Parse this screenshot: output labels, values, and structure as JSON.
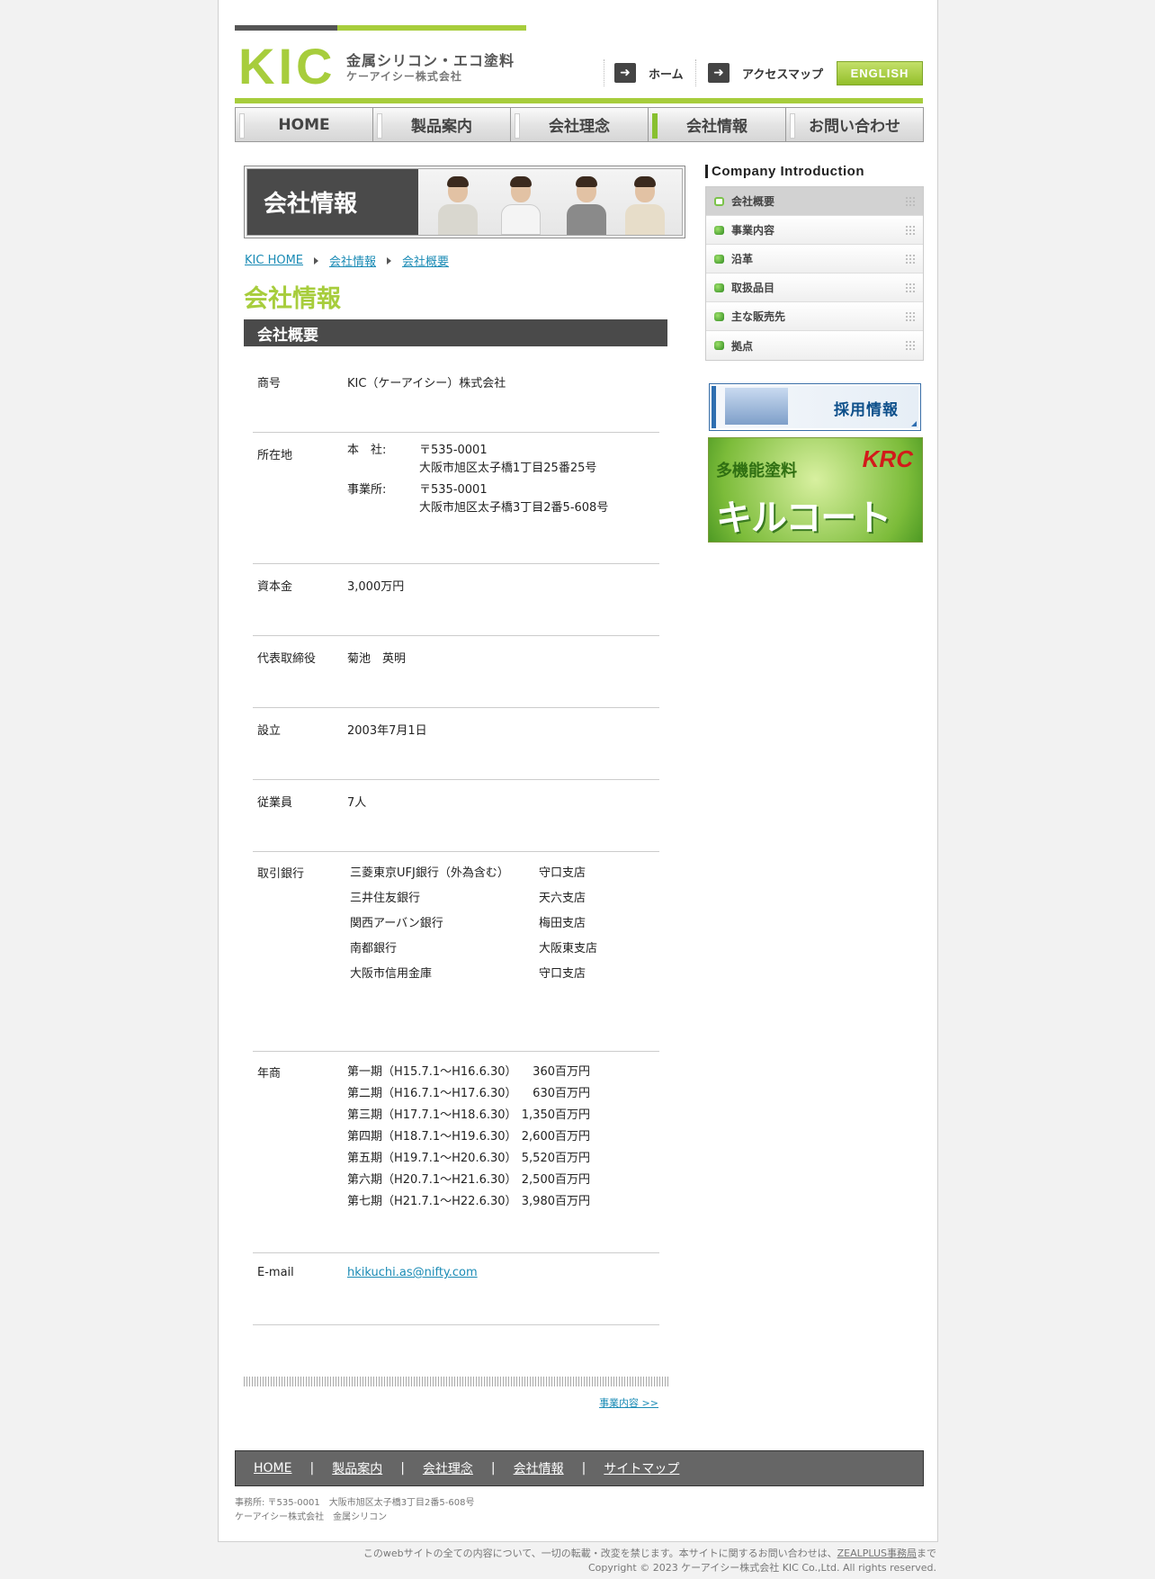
{
  "header": {
    "logo": "KIC",
    "tagline": "金属シリコン・エコ塗料",
    "company_sub": "ケーアイシー株式会社",
    "util_links": [
      {
        "label": "ホーム",
        "icon": "arrow-right-icon"
      },
      {
        "label": "アクセスマップ",
        "icon": "arrow-right-icon"
      }
    ],
    "english_label": "ENGLISH"
  },
  "nav": {
    "tabs": [
      {
        "label": "HOME"
      },
      {
        "label": "製品案内"
      },
      {
        "label": "会社理念"
      },
      {
        "label": "会社情報"
      },
      {
        "label": "お問い合わせ"
      }
    ],
    "active_index": 3
  },
  "banner": {
    "title": "会社情報"
  },
  "breadcrumb": [
    "KIC HOME",
    "会社情報",
    "会社概要"
  ],
  "page_heading": "会社情報",
  "section_title": "会社概要",
  "info": {
    "trade_name": {
      "label": "商号",
      "value": "KIC（ケーアイシー）株式会社"
    },
    "location": {
      "label": "所在地",
      "entries": [
        {
          "kind": "本　社:",
          "zip": "〒535-0001",
          "address": "大阪市旭区太子橋1丁目25番25号"
        },
        {
          "kind": "事業所:",
          "zip": "〒535-0001",
          "address": "大阪市旭区太子橋3丁目2番5-608号"
        }
      ]
    },
    "capital": {
      "label": "資本金",
      "value": "3,000万円"
    },
    "representative": {
      "label": "代表取締役",
      "value": "菊池　英明"
    },
    "established": {
      "label": "設立",
      "value": "2003年7月1日"
    },
    "employees": {
      "label": "従業員",
      "value": "7人"
    },
    "banks": {
      "label": "取引銀行",
      "items": [
        {
          "bank": "三菱東京UFJ銀行（外為含む）",
          "branch": "守口支店"
        },
        {
          "bank": "三井住友銀行",
          "branch": "天六支店"
        },
        {
          "bank": "関西アーバン銀行",
          "branch": "梅田支店"
        },
        {
          "bank": "南都銀行",
          "branch": "大阪東支店"
        },
        {
          "bank": "大阪市信用金庫",
          "branch": "守口支店"
        }
      ]
    },
    "revenue": {
      "label": "年商",
      "items": [
        {
          "period": "第一期（H15.7.1〜H16.6.30）",
          "amount": "360百万円"
        },
        {
          "period": "第二期（H16.7.1〜H17.6.30）",
          "amount": "630百万円"
        },
        {
          "period": "第三期（H17.7.1〜H18.6.30）",
          "amount": "1,350百万円"
        },
        {
          "period": "第四期（H18.7.1〜H19.6.30）",
          "amount": "2,600百万円"
        },
        {
          "period": "第五期（H19.7.1〜H20.6.30）",
          "amount": "5,520百万円"
        },
        {
          "period": "第六期（H20.7.1〜H21.6.30）",
          "amount": "2,500百万円"
        },
        {
          "period": "第七期（H21.7.1〜H22.6.30）",
          "amount": "3,980百万円"
        }
      ]
    },
    "email": {
      "label": "E-mail",
      "value": "hkikuchi.as@nifty.com"
    }
  },
  "next_link": "事業内容 >>",
  "sidebar": {
    "heading": "Company Introduction",
    "items": [
      {
        "label": "会社概要",
        "active": true
      },
      {
        "label": "事業内容"
      },
      {
        "label": "沿革"
      },
      {
        "label": "取扱品目"
      },
      {
        "label": "主な販売先"
      },
      {
        "label": "拠点"
      }
    ],
    "recruit_label": "採用情報",
    "kc_banner": {
      "sub": "多機能塗料",
      "main": "キルコート",
      "logo": "KRC"
    }
  },
  "footer": {
    "links": [
      "HOME",
      "製品案内",
      "会社理念",
      "会社情報",
      "サイトマップ"
    ],
    "address_line1": "事務所: 〒535-0001　大阪市旭区太子橋3丁目2番5-608号",
    "address_line2": "ケーアイシー株式会社　金属シリコン",
    "notice_prefix": "このwebサイトの全ての内容について、一切の転載・改変を禁じます。本サイトに関するお問い合わせは、",
    "notice_link": "ZEALPLUS事務局",
    "notice_suffix": "まで",
    "copyright": "Copyright © 2023 ケーアイシー株式会社 KIC Co.,Ltd. All rights reserved."
  },
  "colors": {
    "brand_green": "#a7cd3c",
    "dark_bar": "#4a4a4a",
    "link": "#1a8bb5"
  }
}
